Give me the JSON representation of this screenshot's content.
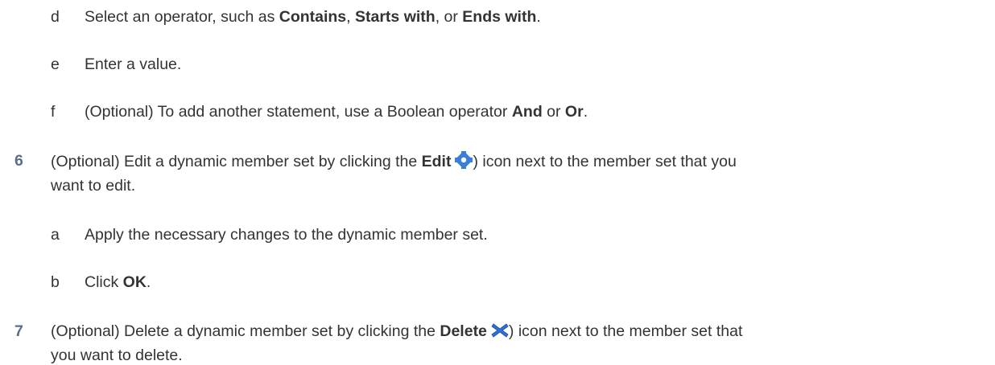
{
  "steps": [
    {
      "marker": "d",
      "parts": [
        "Select an operator, such as ",
        "Contains",
        ", ",
        "Starts with",
        ", or ",
        "Ends with",
        "."
      ]
    },
    {
      "marker": "e",
      "parts": [
        "Enter a value."
      ]
    },
    {
      "marker": "f",
      "parts": [
        "(Optional) To add another statement, use a Boolean operator ",
        "And",
        " or ",
        "Or",
        "."
      ]
    },
    {
      "marker": "6",
      "line1": [
        "(Optional) Edit a dynamic member set by clicking the ",
        "Edit",
        ") icon next to the member set that you"
      ],
      "line2": "want to edit.",
      "icon": "gear-icon",
      "icon_color": "#3a7fd5"
    },
    {
      "marker": "a",
      "parts": [
        "Apply the necessary changes to the dynamic member set."
      ]
    },
    {
      "marker": "b",
      "parts": [
        "Click ",
        "OK",
        "."
      ]
    },
    {
      "marker": "7",
      "line1": [
        "(Optional) Delete a dynamic member set by clicking the ",
        "Delete",
        ") icon next to the member set that"
      ],
      "line2": "you want to delete.",
      "icon": "delete-x-icon",
      "icon_color": "#2f6fd6"
    }
  ],
  "colors": {
    "text": "#333333",
    "step_number": "#5a6e8c"
  }
}
